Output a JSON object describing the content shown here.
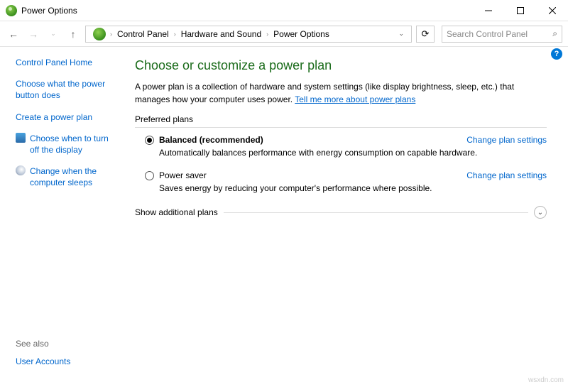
{
  "window": {
    "title": "Power Options"
  },
  "breadcrumb": {
    "items": [
      "Control Panel",
      "Hardware and Sound",
      "Power Options"
    ]
  },
  "search": {
    "placeholder": "Search Control Panel"
  },
  "sidebar": {
    "home": "Control Panel Home",
    "links": [
      "Choose what the power button does",
      "Create a power plan",
      "Choose when to turn off the display",
      "Change when the computer sleeps"
    ],
    "see_also_label": "See also",
    "see_also_item": "User Accounts"
  },
  "main": {
    "heading": "Choose or customize a power plan",
    "description": "A power plan is a collection of hardware and system settings (like display brightness, sleep, etc.) that manages how your computer uses power. ",
    "learn_more": "Tell me more about power plans",
    "preferred_label": "Preferred plans",
    "plans": [
      {
        "name": "Balanced (recommended)",
        "desc": "Automatically balances performance with energy consumption on capable hardware.",
        "link": "Change plan settings",
        "selected": true
      },
      {
        "name": "Power saver",
        "desc": "Saves energy by reducing your computer's performance where possible.",
        "link": "Change plan settings",
        "selected": false
      }
    ],
    "show_more": "Show additional plans"
  },
  "watermark": "wsxdn.com"
}
